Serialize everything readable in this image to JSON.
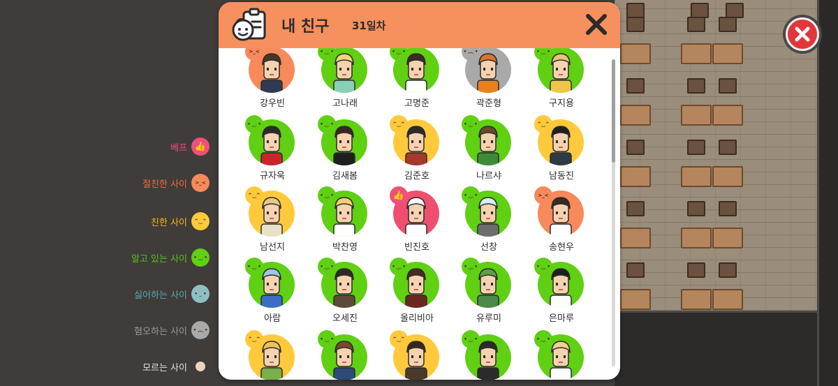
{
  "dialog": {
    "title": "내 친구",
    "day_count": "31일차"
  },
  "legend": [
    {
      "label": "베프",
      "color": "#ef4f7a",
      "face_color": "#ef4f7a",
      "face": "👍",
      "icon": "thumbs-up-icon"
    },
    {
      "label": "절친한 사이",
      "color": "#f36b3b",
      "face_color": "#f7895b",
      "face": ">_<",
      "icon": "grin-squint-face-icon"
    },
    {
      "label": "친한 사이",
      "color": "#f5b90a",
      "face_color": "#ffc93c",
      "face": "^‿^",
      "icon": "happy-face-icon"
    },
    {
      "label": "알고 있는 사이",
      "color": "#55c418",
      "face_color": "#5fd012",
      "face": "• ‿ •",
      "icon": "smile-face-icon"
    },
    {
      "label": "싫어하는 사이",
      "color": "#56a9b3",
      "face_color": "#8ebfc4",
      "face": "• _ •",
      "icon": "neutral-face-icon"
    },
    {
      "label": "혐오하는 사이",
      "color": "#9b9b9b",
      "face_color": "#a9a9a9",
      "face": "• ︵ •",
      "icon": "frown-face-icon"
    },
    {
      "label": "모르는 사이",
      "color": "#e3e3e3",
      "face_color": "#e8d6bd",
      "face": "",
      "icon": "dot-icon"
    }
  ],
  "friends": [
    {
      "name": "강우빈",
      "relation": "절친한 사이",
      "ring": "#f7895b"
    },
    {
      "name": "고나래",
      "relation": "알고 있는 사이",
      "ring": "#5fd012"
    },
    {
      "name": "고명준",
      "relation": "알고 있는 사이",
      "ring": "#5fd012"
    },
    {
      "name": "곽준형",
      "relation": "혐오하는 사이",
      "ring": "#a9a9a9"
    },
    {
      "name": "구지용",
      "relation": "알고 있는 사이",
      "ring": "#5fd012"
    },
    {
      "name": "규자욱",
      "relation": "알고 있는 사이",
      "ring": "#5fd012"
    },
    {
      "name": "김새봄",
      "relation": "알고 있는 사이",
      "ring": "#5fd012"
    },
    {
      "name": "김준호",
      "relation": "친한 사이",
      "ring": "#ffc93c"
    },
    {
      "name": "나르샤",
      "relation": "알고 있는 사이",
      "ring": "#5fd012"
    },
    {
      "name": "남동진",
      "relation": "친한 사이",
      "ring": "#ffc93c"
    },
    {
      "name": "남선지",
      "relation": "친한 사이",
      "ring": "#ffc93c"
    },
    {
      "name": "박찬영",
      "relation": "알고 있는 사이",
      "ring": "#5fd012"
    },
    {
      "name": "빈진호",
      "relation": "베프",
      "ring": "#ef4f6f"
    },
    {
      "name": "선창",
      "relation": "알고 있는 사이",
      "ring": "#5fd012"
    },
    {
      "name": "송현우",
      "relation": "절친한 사이",
      "ring": "#f7895b"
    },
    {
      "name": "아람",
      "relation": "알고 있는 사이",
      "ring": "#5fd012"
    },
    {
      "name": "오세진",
      "relation": "알고 있는 사이",
      "ring": "#5fd012"
    },
    {
      "name": "올리비아",
      "relation": "알고 있는 사이",
      "ring": "#5fd012"
    },
    {
      "name": "유루미",
      "relation": "알고 있는 사이",
      "ring": "#5fd012"
    },
    {
      "name": "은마루",
      "relation": "알고 있는 사이",
      "ring": "#5fd012"
    },
    {
      "name": "",
      "relation": "친한 사이",
      "ring": "#ffc93c"
    },
    {
      "name": "",
      "relation": "알고 있는 사이",
      "ring": "#5fd012"
    },
    {
      "name": "",
      "relation": "친한 사이",
      "ring": "#ffc93c"
    },
    {
      "name": "",
      "relation": "알고 있는 사이",
      "ring": "#5fd012"
    },
    {
      "name": "",
      "relation": "알고 있는 사이",
      "ring": "#5fd012"
    }
  ],
  "icons": {
    "header": "friend-notebook-icon",
    "dialog_close": "close-icon",
    "screen_close": "close-circle-icon"
  }
}
